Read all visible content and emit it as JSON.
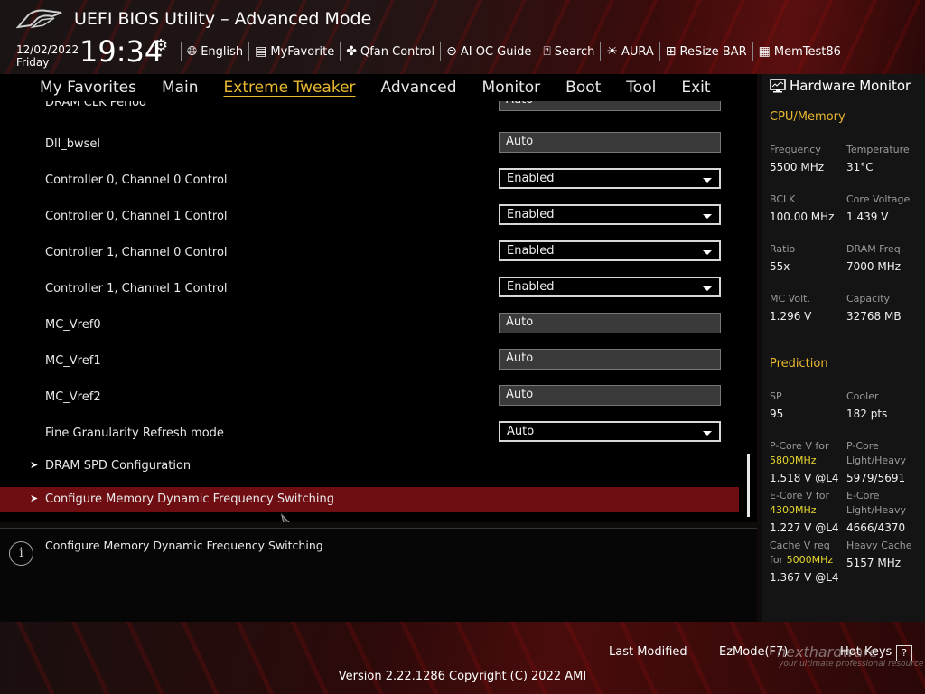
{
  "header": {
    "title": "UEFI BIOS Utility – Advanced Mode",
    "date": "12/02/2022",
    "day": "Friday",
    "time": "19:34",
    "toolbar": [
      {
        "label": "English",
        "icon": "globe-icon"
      },
      {
        "label": "MyFavorite",
        "icon": "favorite-icon"
      },
      {
        "label": "Qfan Control",
        "icon": "fan-icon"
      },
      {
        "label": "AI OC Guide",
        "icon": "ai-guide-icon"
      },
      {
        "label": "Search",
        "icon": "search-icon"
      },
      {
        "label": "AURA",
        "icon": "aura-icon"
      },
      {
        "label": "ReSize BAR",
        "icon": "resize-bar-icon"
      },
      {
        "label": "MemTest86",
        "icon": "memtest-icon"
      }
    ]
  },
  "nav": {
    "tabs": [
      "My Favorites",
      "Main",
      "Extreme Tweaker",
      "Advanced",
      "Monitor",
      "Boot",
      "Tool",
      "Exit"
    ],
    "active": "Extreme Tweaker"
  },
  "settings": [
    {
      "label": "DRAM CLK Period",
      "value": "Auto",
      "type": "text"
    },
    {
      "label": "Dll_bwsel",
      "value": "Auto",
      "type": "text"
    },
    {
      "label": "Controller 0, Channel 0 Control",
      "value": "Enabled",
      "type": "dropdown"
    },
    {
      "label": "Controller 0, Channel 1 Control",
      "value": "Enabled",
      "type": "dropdown"
    },
    {
      "label": "Controller 1, Channel 0 Control",
      "value": "Enabled",
      "type": "dropdown"
    },
    {
      "label": "Controller 1, Channel 1 Control",
      "value": "Enabled",
      "type": "dropdown"
    },
    {
      "label": "MC_Vref0",
      "value": "Auto",
      "type": "text"
    },
    {
      "label": "MC_Vref1",
      "value": "Auto",
      "type": "text"
    },
    {
      "label": "MC_Vref2",
      "value": "Auto",
      "type": "text"
    },
    {
      "label": "Fine Granularity Refresh mode",
      "value": "Auto",
      "type": "dropdown"
    }
  ],
  "submenus": [
    {
      "label": "DRAM SPD Configuration"
    },
    {
      "label": "Configure Memory Dynamic Frequency Switching"
    }
  ],
  "help": {
    "text": "Configure Memory Dynamic Frequency Switching"
  },
  "hw_monitor": {
    "title": "Hardware Monitor",
    "cpu_section": "CPU/Memory",
    "frequency_label": "Frequency",
    "frequency": "5500 MHz",
    "temperature_label": "Temperature",
    "temperature": "31°C",
    "bclk_label": "BCLK",
    "bclk": "100.00 MHz",
    "core_voltage_label": "Core Voltage",
    "core_voltage": "1.439 V",
    "ratio_label": "Ratio",
    "ratio": "55x",
    "dram_freq_label": "DRAM Freq.",
    "dram_freq": "7000 MHz",
    "mc_volt_label": "MC Volt.",
    "mc_volt": "1.296 V",
    "capacity_label": "Capacity",
    "capacity": "32768 MB",
    "prediction_section": "Prediction",
    "sp_label": "SP",
    "sp": "95",
    "cooler_label": "Cooler",
    "cooler": "182 pts",
    "pcore_v_label": "P-Core V for",
    "pcore_v_freq": "5800MHz",
    "pcore_v": "1.518 V @L4",
    "pcore_lh_label1": "P-Core",
    "pcore_lh_label2": "Light/Heavy",
    "pcore_lh": "5979/5691",
    "ecore_v_label": "E-Core V for",
    "ecore_v_freq": "4300MHz",
    "ecore_v": "1.227 V @L4",
    "ecore_lh_label1": "E-Core",
    "ecore_lh_label2": "Light/Heavy",
    "ecore_lh": "4666/4370",
    "cache_v_label1": "Cache V req",
    "cache_v_label2": "for",
    "cache_v_freq": "5000MHz",
    "cache_v": "1.367 V @L4",
    "heavy_cache_label": "Heavy Cache",
    "heavy_cache": "5157 MHz"
  },
  "footer": {
    "last_modified": "Last Modified",
    "ezmode": "EzMode(F7)",
    "hotkeys": "Hot Keys",
    "hotkeys_key": "?",
    "version": "Version 2.22.1286 Copyright (C) 2022 AMI",
    "watermark": "nexthardware",
    "watermark_sub": "your ultimate professional resource"
  }
}
